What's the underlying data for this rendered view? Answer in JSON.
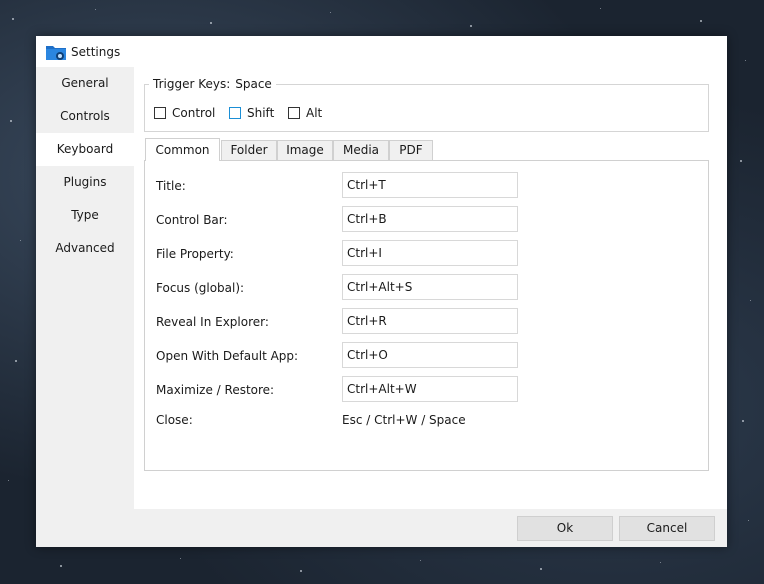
{
  "window": {
    "title": "Settings"
  },
  "sidebar": {
    "items": [
      {
        "label": "General"
      },
      {
        "label": "Controls"
      },
      {
        "label": "Keyboard"
      },
      {
        "label": "Plugins"
      },
      {
        "label": "Type"
      },
      {
        "label": "Advanced"
      }
    ],
    "active": "Keyboard"
  },
  "trigger": {
    "label": "Trigger Keys:",
    "value": "Space",
    "options": [
      {
        "label": "Control",
        "checked": false
      },
      {
        "label": "Shift",
        "checked": false
      },
      {
        "label": "Alt",
        "checked": false
      }
    ]
  },
  "tabs": [
    {
      "label": "Common"
    },
    {
      "label": "Folder"
    },
    {
      "label": "Image"
    },
    {
      "label": "Media"
    },
    {
      "label": "PDF"
    }
  ],
  "active_tab": "Common",
  "shortcuts": [
    {
      "label": "Title:",
      "value": "Ctrl+T"
    },
    {
      "label": "Control Bar:",
      "value": "Ctrl+B"
    },
    {
      "label": "File Property:",
      "value": "Ctrl+I"
    },
    {
      "label": "Focus (global):",
      "value": "Ctrl+Alt+S"
    },
    {
      "label": "Reveal In Explorer:",
      "value": "Ctrl+R"
    },
    {
      "label": "Open With Default App:",
      "value": "Ctrl+O"
    },
    {
      "label": "Maximize / Restore:",
      "value": "Ctrl+Alt+W"
    },
    {
      "label": "Close:",
      "value": "Esc / Ctrl+W / Space"
    }
  ],
  "footer": {
    "ok_label": "Ok",
    "cancel_label": "Cancel"
  },
  "colors": {
    "accent": "#1b8fd6",
    "icon_blue": "#1e6fc8"
  }
}
